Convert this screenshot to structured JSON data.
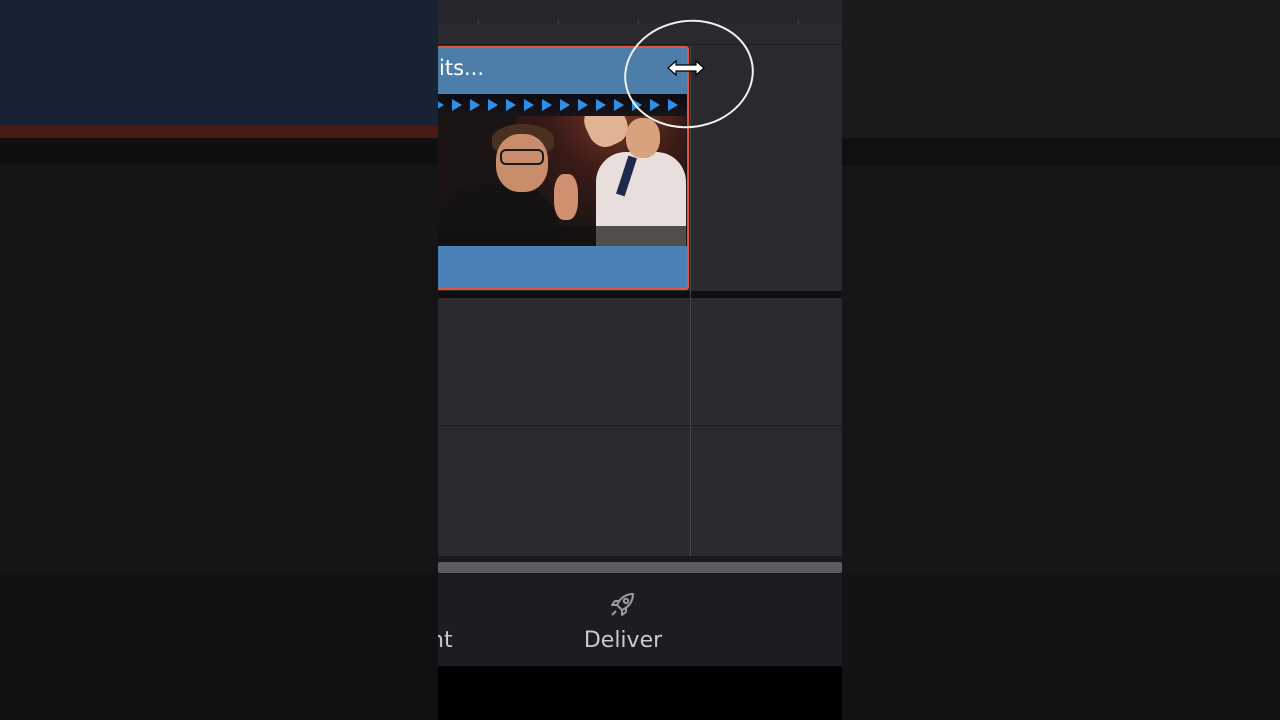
{
  "timeline": {
    "clip": {
      "title": "its...",
      "border_color": "#e0583c",
      "header_color": "#4d7eaa",
      "marker_color": "#2f8fe6"
    },
    "cursor": "horizontal-resize-cursor"
  },
  "page_bar": {
    "items": [
      {
        "label": "nt",
        "icon": "edit-page-icon"
      },
      {
        "label": "Deliver",
        "icon": "rocket-icon"
      }
    ]
  },
  "colors": {
    "track_bg": "#2a2930",
    "page_bar_bg": "#1d1d21",
    "annotation": "#f0f0f0"
  }
}
